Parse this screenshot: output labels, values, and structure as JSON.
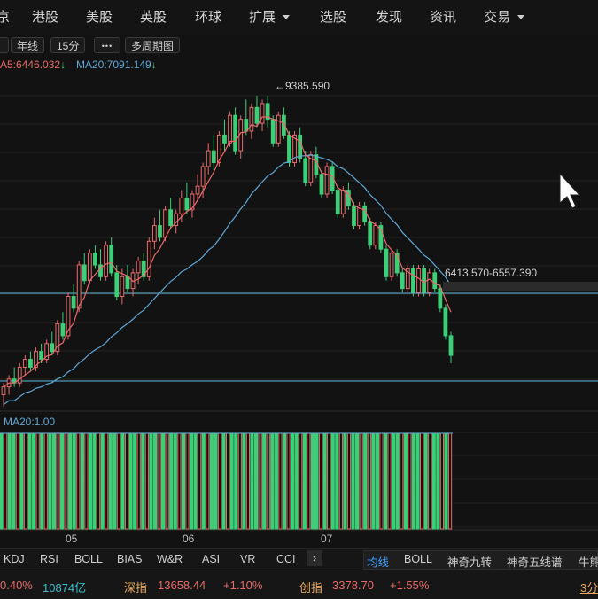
{
  "topnav": {
    "items": [
      {
        "label": "京",
        "caret": false
      },
      {
        "label": "港股",
        "caret": false
      },
      {
        "label": "美股",
        "caret": false
      },
      {
        "label": "英股",
        "caret": false
      },
      {
        "label": "环球",
        "caret": false
      },
      {
        "label": "扩展",
        "caret": true
      },
      {
        "label": "选股",
        "caret": false
      },
      {
        "label": "发现",
        "caret": false
      },
      {
        "label": "资讯",
        "caret": false
      },
      {
        "label": "交易",
        "caret": true
      }
    ]
  },
  "toolbar": {
    "year_line": "年线",
    "period": "15分",
    "more": "•••",
    "multi_period": "多周期图"
  },
  "main_chart": {
    "legend": {
      "ma5": "A5:6446.032",
      "ma20": "MA20:7091.149",
      "ma5_arrow": "↓",
      "ma20_arrow": "↓"
    },
    "high_label": "←9385.590",
    "range_label": "6413.570-6557.390",
    "colors": {
      "up": "#e86a6a",
      "down": "#3ccf78",
      "ma5": "#ec6a6a",
      "ma20": "#5ea8d6",
      "hline": "#5fb8dc"
    }
  },
  "sub_chart": {
    "legend": "MA20:1.00"
  },
  "x_axis": {
    "labels": [
      "05",
      "06",
      "07"
    ]
  },
  "indicators": {
    "left": [
      "KDJ",
      "RSI",
      "BOLL",
      "BIAS",
      "W&R",
      "ASI",
      "VR",
      "CCI"
    ],
    "right": [
      "均线",
      "BOLL",
      "神奇九转",
      "神奇五线谱",
      "牛熊"
    ],
    "active": "均线"
  },
  "ticker": {
    "first_change": "0.40%",
    "volume": "10874亿",
    "sz_name": "深指",
    "sz_value": "13658.44",
    "sz_change": "+1.10%",
    "cy_name": "创指",
    "cy_value": "3378.70",
    "cy_change": "+1.55%",
    "right_tab": "3分"
  },
  "chart_data": {
    "type": "candlestick",
    "high": 9385.59,
    "range_low": 6413.57,
    "range_high": 6557.39,
    "candles": [
      [
        5.0,
        5.3,
        4.7,
        5.2
      ],
      [
        5.2,
        5.5,
        5.0,
        5.4
      ],
      [
        5.4,
        5.7,
        5.2,
        5.3
      ],
      [
        5.3,
        5.8,
        5.2,
        5.7
      ],
      [
        5.7,
        6.0,
        5.5,
        5.9
      ],
      [
        5.9,
        6.1,
        5.6,
        5.7
      ],
      [
        5.7,
        6.2,
        5.6,
        6.1
      ],
      [
        6.1,
        6.3,
        5.8,
        5.9
      ],
      [
        5.9,
        6.4,
        5.8,
        6.3
      ],
      [
        6.3,
        6.6,
        6.0,
        6.1
      ],
      [
        6.1,
        6.9,
        6.0,
        6.8
      ],
      [
        6.8,
        7.1,
        6.4,
        6.5
      ],
      [
        6.5,
        7.6,
        6.4,
        7.5
      ],
      [
        7.5,
        7.8,
        7.1,
        7.2
      ],
      [
        7.2,
        8.4,
        7.1,
        8.3
      ],
      [
        8.3,
        8.6,
        7.8,
        7.9
      ],
      [
        7.9,
        8.7,
        7.8,
        8.6
      ],
      [
        8.6,
        8.8,
        8.2,
        8.3
      ],
      [
        8.3,
        8.7,
        7.9,
        8.0
      ],
      [
        8.0,
        8.9,
        7.9,
        8.8
      ],
      [
        8.8,
        9.0,
        8.0,
        8.1
      ],
      [
        8.1,
        8.3,
        7.4,
        7.5
      ],
      [
        7.5,
        8.2,
        7.3,
        8.0
      ],
      [
        8.0,
        8.3,
        7.6,
        7.7
      ],
      [
        7.7,
        8.2,
        7.5,
        8.1
      ],
      [
        8.1,
        8.5,
        7.8,
        8.4
      ],
      [
        8.4,
        8.6,
        7.9,
        8.0
      ],
      [
        8.0,
        9.0,
        7.9,
        8.9
      ],
      [
        8.9,
        9.5,
        8.7,
        9.3
      ],
      [
        9.3,
        9.7,
        8.9,
        9.0
      ],
      [
        9.0,
        9.8,
        8.9,
        9.7
      ],
      [
        9.7,
        10.0,
        9.2,
        9.3
      ],
      [
        9.3,
        9.7,
        9.1,
        9.6
      ],
      [
        9.6,
        10.2,
        9.4,
        10.0
      ],
      [
        10.0,
        10.4,
        9.6,
        9.7
      ],
      [
        9.7,
        10.2,
        9.5,
        10.1
      ],
      [
        10.1,
        10.6,
        9.9,
        10.3
      ],
      [
        10.3,
        10.9,
        10.0,
        10.8
      ],
      [
        10.8,
        11.4,
        10.6,
        11.2
      ],
      [
        11.2,
        11.6,
        10.7,
        10.9
      ],
      [
        10.9,
        11.7,
        10.8,
        11.6
      ],
      [
        11.6,
        12.0,
        11.2,
        11.4
      ],
      [
        11.4,
        12.2,
        11.3,
        12.1
      ],
      [
        12.1,
        12.3,
        11.1,
        11.2
      ],
      [
        11.2,
        12.1,
        11.0,
        12.0
      ],
      [
        12.0,
        12.5,
        11.6,
        11.7
      ],
      [
        11.7,
        12.4,
        11.5,
        12.3
      ],
      [
        12.3,
        12.6,
        11.8,
        11.9
      ],
      [
        11.9,
        12.5,
        11.7,
        12.4
      ],
      [
        12.4,
        12.6,
        11.8,
        12.0
      ],
      [
        12.0,
        12.1,
        11.3,
        11.4
      ],
      [
        11.4,
        12.2,
        11.3,
        12.1
      ],
      [
        12.1,
        12.3,
        11.5,
        11.6
      ],
      [
        11.6,
        11.7,
        10.8,
        10.9
      ],
      [
        10.9,
        11.7,
        10.8,
        11.6
      ],
      [
        11.6,
        11.8,
        10.9,
        11.0
      ],
      [
        11.0,
        11.2,
        10.3,
        10.4
      ],
      [
        10.4,
        11.2,
        10.3,
        11.1
      ],
      [
        11.1,
        11.3,
        10.5,
        10.6
      ],
      [
        10.6,
        10.7,
        10.0,
        10.1
      ],
      [
        10.1,
        10.9,
        10.0,
        10.8
      ],
      [
        10.8,
        10.9,
        10.1,
        10.2
      ],
      [
        10.2,
        10.3,
        9.5,
        9.6
      ],
      [
        9.6,
        10.3,
        9.5,
        10.2
      ],
      [
        10.2,
        10.4,
        9.7,
        9.8
      ],
      [
        9.8,
        9.9,
        9.2,
        9.3
      ],
      [
        9.3,
        9.9,
        9.2,
        9.8
      ],
      [
        9.8,
        9.9,
        9.3,
        9.4
      ],
      [
        9.4,
        9.5,
        8.7,
        8.8
      ],
      [
        8.8,
        9.4,
        8.7,
        9.3
      ],
      [
        9.3,
        9.4,
        8.6,
        8.7
      ],
      [
        8.7,
        8.8,
        7.9,
        8.0
      ],
      [
        8.0,
        8.7,
        7.9,
        8.6
      ],
      [
        8.6,
        8.7,
        8.0,
        8.1
      ],
      [
        8.1,
        8.2,
        7.6,
        7.7
      ],
      [
        7.7,
        8.3,
        7.6,
        8.2
      ],
      [
        8.2,
        8.3,
        7.5,
        7.6
      ],
      [
        7.6,
        8.3,
        7.5,
        8.2
      ],
      [
        8.2,
        8.3,
        7.5,
        7.6
      ],
      [
        7.6,
        8.2,
        7.5,
        8.1
      ],
      [
        8.1,
        8.2,
        7.6,
        7.7
      ],
      [
        7.7,
        7.8,
        7.1,
        7.2
      ],
      [
        7.2,
        7.3,
        6.4,
        6.5
      ],
      [
        6.5,
        6.6,
        5.8,
        6.0
      ]
    ]
  }
}
